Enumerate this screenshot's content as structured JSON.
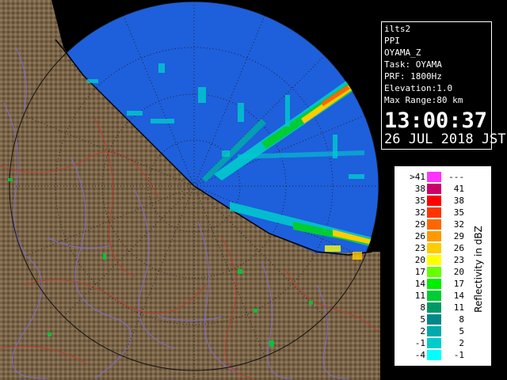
{
  "info": {
    "lines": [
      "ilts2",
      "PPI",
      "OYAMA_Z",
      "Task: OYAMA",
      "PRF: 1800Hz",
      "Elevation:1.0",
      "Max Range:80 km"
    ],
    "time": "13:00:37",
    "date": "26 JUL 2018 JST"
  },
  "legend": {
    "title": "Reflectivity in dBZ",
    "rows": [
      {
        "low": ">41",
        "high": "---",
        "color": "#ff33ff"
      },
      {
        "low": "38",
        "high": "41",
        "color": "#cc0066"
      },
      {
        "low": "35",
        "high": "38",
        "color": "#ff0000"
      },
      {
        "low": "32",
        "high": "35",
        "color": "#ff3300"
      },
      {
        "low": "29",
        "high": "32",
        "color": "#ff6600"
      },
      {
        "low": "26",
        "high": "29",
        "color": "#ff9900"
      },
      {
        "low": "23",
        "high": "26",
        "color": "#ffcc00"
      },
      {
        "low": "20",
        "high": "23",
        "color": "#ffff00"
      },
      {
        "low": "17",
        "high": "20",
        "color": "#66ff00"
      },
      {
        "low": "14",
        "high": "17",
        "color": "#00ee00"
      },
      {
        "low": "11",
        "high": "14",
        "color": "#00cc33"
      },
      {
        "low": "8",
        "high": "11",
        "color": "#009966"
      },
      {
        "low": "5",
        "high": "8",
        "color": "#008888"
      },
      {
        "low": "2",
        "high": "5",
        "color": "#00aaaa"
      },
      {
        "low": "-1",
        "high": "2",
        "color": "#00cccc"
      },
      {
        "low": "-4",
        "high": "-1",
        "color": "#00ffff"
      }
    ]
  },
  "colors": {
    "sea": "#1e5fdc",
    "land": "#7a6448",
    "rings": "#222222",
    "roads": "#c0392b",
    "rivers": "#7f6fd8"
  }
}
